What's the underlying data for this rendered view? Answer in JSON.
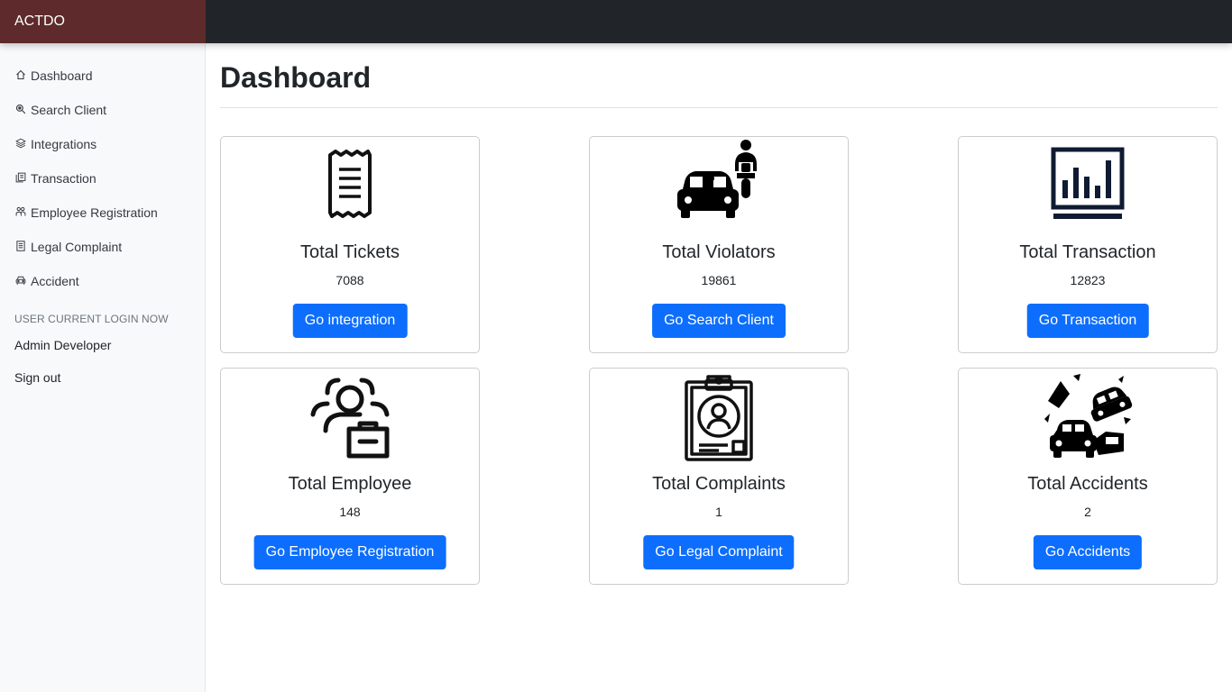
{
  "brand": "ACTDO",
  "sidebar": {
    "items": [
      {
        "label": "Dashboard",
        "icon": "house-icon"
      },
      {
        "label": "Search Client",
        "icon": "search-icon"
      },
      {
        "label": "Integrations",
        "icon": "layers-icon"
      },
      {
        "label": "Transaction",
        "icon": "documents-icon"
      },
      {
        "label": "Employee Registration",
        "icon": "people-icon"
      },
      {
        "label": "Legal Complaint",
        "icon": "file-text-icon"
      },
      {
        "label": "Accident",
        "icon": "car-icon"
      }
    ],
    "heading": "USER CURRENT LOGIN NOW",
    "user": "Admin Developer",
    "signout": "Sign out"
  },
  "main": {
    "title": "Dashboard",
    "cards": [
      {
        "title": "Total Tickets",
        "value": "7088",
        "button": "Go integration",
        "icon": "receipt-icon"
      },
      {
        "title": "Total Violators",
        "value": "19861",
        "button": "Go Search Client",
        "icon": "car-motorcycle-icon"
      },
      {
        "title": "Total Transaction",
        "value": "12823",
        "button": "Go Transaction",
        "icon": "bar-chart-icon"
      },
      {
        "title": "Total Employee",
        "value": "148",
        "button": "Go Employee Registration",
        "icon": "employee-briefcase-icon"
      },
      {
        "title": "Total Complaints",
        "value": "1",
        "button": "Go Legal Complaint",
        "icon": "clipboard-profile-icon"
      },
      {
        "title": "Total Accidents",
        "value": "2",
        "button": "Go Accidents",
        "icon": "car-crash-icon"
      }
    ]
  },
  "colors": {
    "brand_bg": "#5e2a2b",
    "topbar_bg": "#212529",
    "button": "#0d6efd",
    "sidebar_bg": "#f8f9fa"
  }
}
